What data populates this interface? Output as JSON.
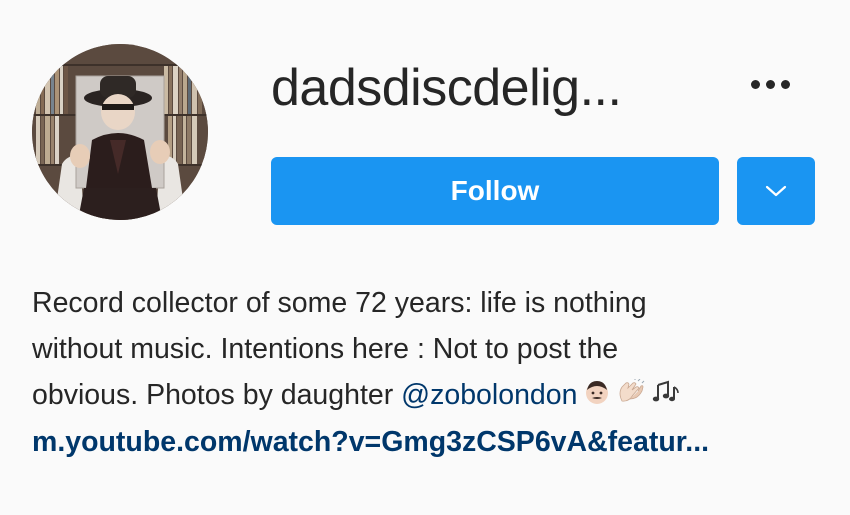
{
  "profile": {
    "username": "dadsdiscdelig...",
    "avatar_alt": "profile-photo"
  },
  "actions": {
    "follow_label": "Follow",
    "more_icon": "more-horizontal-icon",
    "dropdown_icon": "chevron-down-icon"
  },
  "bio": {
    "line1": "Record collector of some 72 years: life is nothing",
    "line2": "without music. Intentions here : Not to post the",
    "line3_prefix": "obvious. Photos by daughter ",
    "mention": "@zobolondon",
    "emojis": [
      "man-emoji",
      "clapping-hands-emoji",
      "music-notes-emoji"
    ],
    "link": "m.youtube.com/watch?v=Gmg3zCSP6vA&featur..."
  },
  "colors": {
    "background": "#fafafa",
    "primary_button": "#1a95f2",
    "text": "#262626",
    "link": "#00376b"
  }
}
